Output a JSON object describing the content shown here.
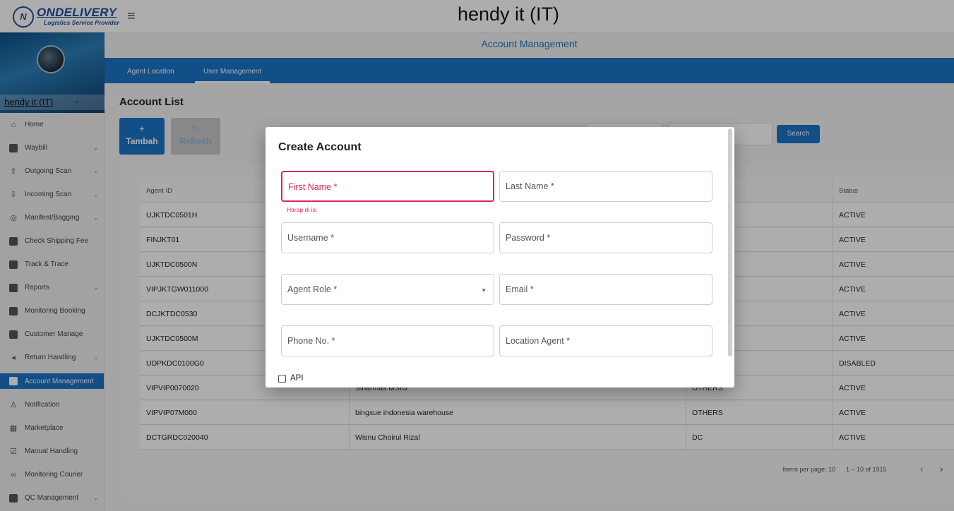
{
  "header": {
    "logo_text": "ONDELIVERY",
    "logo_sub": "Logistics Service Provider",
    "logo_mark": "N",
    "page_title": "hendy it (IT)",
    "menu_icon": "hamburger-icon"
  },
  "user": {
    "name": "hendy it (IT)"
  },
  "sidebar": {
    "items": [
      {
        "label": "Home",
        "icon": "home-icon",
        "caret": false
      },
      {
        "label": "Waybill",
        "icon": "waybill-icon",
        "caret": true
      },
      {
        "label": "Outgoing Scan",
        "icon": "upload-icon",
        "caret": true
      },
      {
        "label": "Incoming Scan",
        "icon": "download-icon",
        "caret": true
      },
      {
        "label": "Manifest/Bagging",
        "icon": "scan-icon",
        "caret": true
      },
      {
        "label": "Check Shipping Fee",
        "icon": "fee-icon",
        "caret": false
      },
      {
        "label": "Track & Trace",
        "icon": "track-icon",
        "caret": false
      },
      {
        "label": "Reports",
        "icon": "reports-icon",
        "caret": true
      },
      {
        "label": "Monitoring Booking",
        "icon": "booking-icon",
        "caret": false
      },
      {
        "label": "Customer Manage",
        "icon": "customer-icon",
        "caret": false
      },
      {
        "label": "Return Handling",
        "icon": "return-icon",
        "caret": true
      },
      {
        "label": "Account Management",
        "icon": "account-icon",
        "caret": false,
        "active": true
      },
      {
        "label": "Notification",
        "icon": "bell-icon",
        "caret": false
      },
      {
        "label": "Marketplace",
        "icon": "store-icon",
        "caret": false
      },
      {
        "label": "Manual Handling",
        "icon": "check-icon",
        "caret": false
      },
      {
        "label": "Monitoring Courier",
        "icon": "bike-icon",
        "caret": false
      },
      {
        "label": "QC Management",
        "icon": "qc-icon",
        "caret": true
      }
    ]
  },
  "main": {
    "section_title": "Account Management",
    "tabs": [
      {
        "label": "Agent Location"
      },
      {
        "label": "User Management",
        "selected": true
      }
    ],
    "list_title": "Account List",
    "buttons": {
      "tambah": "Tambah",
      "refresh": "Refresh",
      "search": "Search"
    },
    "table": {
      "headers": [
        "Agent ID",
        "",
        "",
        "Status"
      ],
      "rows": [
        [
          "UJKTDC0501H",
          "",
          "",
          "ACTIVE"
        ],
        [
          "FINJKT01",
          "",
          "",
          "ACTIVE"
        ],
        [
          "UJKTDC0500N",
          "",
          "",
          "ACTIVE"
        ],
        [
          "VIPJKTGW011000",
          "",
          "",
          "ACTIVE"
        ],
        [
          "DCJKTDC0530",
          "",
          "",
          "ACTIVE"
        ],
        [
          "UJKTDC0500M",
          "",
          "",
          "ACTIVE"
        ],
        [
          "UDPKDC0100G0",
          "",
          "",
          "DISABLED"
        ],
        [
          "VIPVIP0070020",
          "Sinarmas MSIG",
          "OTHERS",
          "ACTIVE"
        ],
        [
          "VIPVIP07M000",
          "bingxue indonesia warehouse",
          "OTHERS",
          "ACTIVE"
        ],
        [
          "DCTGRDC020040",
          "Wisnu Choirul Rizal",
          "DC",
          "ACTIVE"
        ]
      ]
    },
    "paginator": {
      "items_per_page": "Items per page: 10",
      "range": "1 – 10 of 1915"
    }
  },
  "modal": {
    "title": "Create Account",
    "fields": {
      "first_name": "First Name *",
      "last_name": "Last Name *",
      "username": "Username *",
      "password": "Password *",
      "agent_role": "Agent Role *",
      "email": "Email *",
      "phone": "Phone No. *",
      "location_agent": "Location Agent *"
    },
    "error": "Harap di isi",
    "api_label": "API"
  },
  "colors": {
    "primary": "#1b74c9",
    "error": "#e0245e",
    "overlay": "rgba(0,0,0,0.32)"
  }
}
